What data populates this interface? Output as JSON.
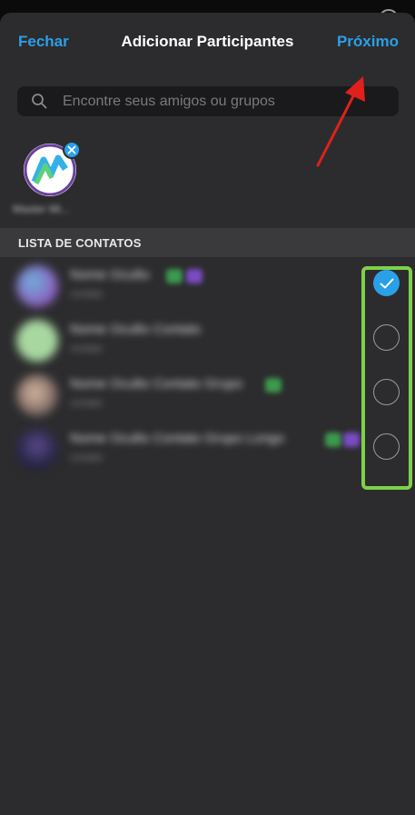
{
  "header": {
    "left_label": "Fechar",
    "title": "Adicionar Participantes",
    "right_label": "Próximo"
  },
  "search": {
    "placeholder": "Encontre seus amigos ou grupos",
    "value": ""
  },
  "selected": {
    "name": "Master Mi..."
  },
  "contacts_section": {
    "label": "LISTA DE CONTATOS"
  },
  "contacts": [
    {
      "name": "Nome Oculto",
      "sub": "contato",
      "selected": true
    },
    {
      "name": "Nome Oculto Contato",
      "sub": "contato",
      "selected": false
    },
    {
      "name": "Nome Oculto Contato Grupo",
      "sub": "contato",
      "selected": false
    },
    {
      "name": "Nome Oculto Contato Grupo Longo",
      "sub": "contato",
      "selected": false
    }
  ],
  "colors": {
    "accent": "#2aa0e8",
    "highlight": "#7ed04a",
    "arrow": "#e0201c",
    "background": "#2c2c2e"
  },
  "icons": {
    "search": "search-icon",
    "remove": "close-icon",
    "check": "check-icon"
  }
}
